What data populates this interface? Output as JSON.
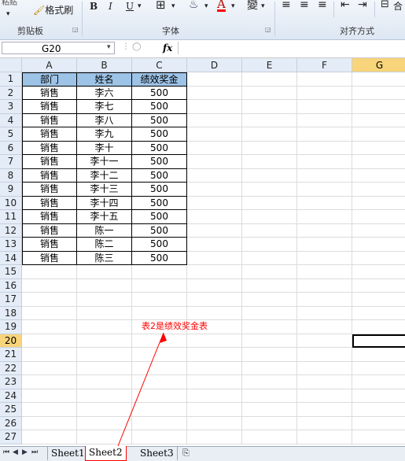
{
  "ribbon": {
    "groups": [
      {
        "label": "剪贴板"
      },
      {
        "label": "字体"
      },
      {
        "label": "对齐方式"
      }
    ],
    "format_painter_label": "格式刷",
    "clipboard_partial_label": "粘贴",
    "bold": "B",
    "italic": "I",
    "underline": "U",
    "font_color_letter": "A",
    "phonetic_char": "變",
    "merge_partial": "合"
  },
  "formula_bar": {
    "name_box": "G20",
    "fx_label": "fx",
    "formula": ""
  },
  "sheet": {
    "columns": [
      "A",
      "B",
      "C",
      "D",
      "E",
      "F",
      "G"
    ],
    "selected_column": "G",
    "selected_row": 20,
    "rows": [
      "1",
      "2",
      "3",
      "4",
      "5",
      "6",
      "7",
      "8",
      "9",
      "10",
      "11",
      "12",
      "13",
      "14",
      "15",
      "16",
      "17",
      "18",
      "19",
      "20",
      "21",
      "22",
      "23",
      "24",
      "25",
      "26",
      "27"
    ],
    "table_header": [
      "部门",
      "姓名",
      "绩效奖金"
    ],
    "table_rows": [
      [
        "销售",
        "李六",
        "500"
      ],
      [
        "销售",
        "李七",
        "500"
      ],
      [
        "销售",
        "李八",
        "500"
      ],
      [
        "销售",
        "李九",
        "500"
      ],
      [
        "销售",
        "李十",
        "500"
      ],
      [
        "销售",
        "李十一",
        "500"
      ],
      [
        "销售",
        "李十二",
        "500"
      ],
      [
        "销售",
        "李十三",
        "500"
      ],
      [
        "销售",
        "李十四",
        "500"
      ],
      [
        "销售",
        "李十五",
        "500"
      ],
      [
        "销售",
        "陈一",
        "500"
      ],
      [
        "销售",
        "陈二",
        "500"
      ],
      [
        "销售",
        "陈三",
        "500"
      ]
    ],
    "annotation": "表2是绩效奖金表"
  },
  "colors": {
    "header_fill": "#9dc3e6",
    "selected_header": "#f8d47a",
    "annotation_red": "#ff0000"
  },
  "tabs": [
    {
      "label": "Sheet1",
      "active": false
    },
    {
      "label": "Sheet2",
      "active": true
    },
    {
      "label": "Sheet3",
      "active": false
    }
  ]
}
